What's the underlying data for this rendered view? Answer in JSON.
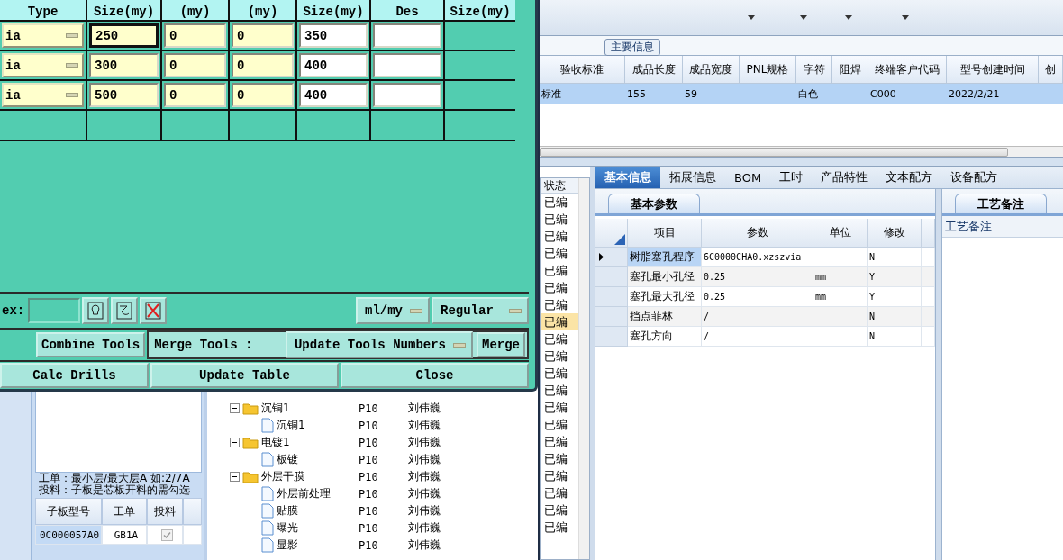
{
  "dialog": {
    "columns": [
      "Type",
      "Size(my)",
      "(my)",
      "(my)",
      "Size(my)",
      "Des",
      "Size(my)"
    ],
    "rows": [
      {
        "type": "ia",
        "size": "250",
        "col_3": "0",
        "col_4": "0",
        "col_5": "350",
        "focused": true
      },
      {
        "type": "ia",
        "size": "300",
        "col_3": "0",
        "col_4": "0",
        "col_5": "400",
        "focused": false
      },
      {
        "type": "ia",
        "size": "500",
        "col_3": "0",
        "col_4": "0",
        "col_5": "400",
        "focused": false
      }
    ],
    "index_label": "ex:",
    "unit": "ml/my",
    "mode": "Regular",
    "combine_button": "Combine Tools",
    "merge_label": "Merge Tools :",
    "merge_option": "Update Tools Numbers",
    "merge_button": "Merge",
    "buttons": [
      "Calc Drills",
      "Update Table",
      "Close"
    ]
  },
  "left_panel": {
    "note_lines": [
      "工单：最小层/最大层A 如:2/7A",
      "投料：子板是芯板开料的需勾选"
    ],
    "columns": [
      "子板型号",
      "工单",
      "投料"
    ],
    "rows": [
      {
        "board": "0C000057A0",
        "order": "GB1A",
        "feed": true
      }
    ]
  },
  "tree": [
    {
      "name": "沉铜1",
      "code": "P10",
      "owner": "刘伟巍",
      "expanded": true,
      "children": [
        {
          "name": "沉铜1",
          "code": "P10",
          "owner": "刘伟巍"
        }
      ]
    },
    {
      "name": "电镀1",
      "code": "P10",
      "owner": "刘伟巍",
      "expanded": true,
      "children": [
        {
          "name": "板镀",
          "code": "P10",
          "owner": "刘伟巍"
        }
      ]
    },
    {
      "name": "外层干膜",
      "code": "P10",
      "owner": "刘伟巍",
      "expanded": true,
      "children": [
        {
          "name": "外层前处理",
          "code": "P10",
          "owner": "刘伟巍"
        },
        {
          "name": "贴膜",
          "code": "P10",
          "owner": "刘伟巍"
        },
        {
          "name": "曝光",
          "code": "P10",
          "owner": "刘伟巍"
        },
        {
          "name": "显影",
          "code": "P10",
          "owner": "刘伟巍"
        }
      ]
    }
  ],
  "main_info": {
    "title": "主要信息",
    "columns": [
      "验收标准",
      "成品长度",
      "成品宽度",
      "PNL规格",
      "字符",
      "阻焊",
      "终端客户代码",
      "型号创建时间",
      "创"
    ],
    "rows": [
      {
        "selected": true,
        "cells": [
          "标准",
          "155",
          "59",
          null,
          "白色",
          null,
          "C000",
          "2022/2/21",
          null
        ]
      }
    ]
  },
  "status": {
    "header": "状态",
    "rows": [
      {
        "text": "已编",
        "selected": false
      },
      {
        "text": "已编",
        "selected": false
      },
      {
        "text": "已编",
        "selected": false
      },
      {
        "text": "已编",
        "selected": false
      },
      {
        "text": "已编",
        "selected": false
      },
      {
        "text": "已编",
        "selected": false
      },
      {
        "text": "已编",
        "selected": false
      },
      {
        "text": "已编",
        "selected": true
      },
      {
        "text": "已编",
        "selected": false
      },
      {
        "text": "已编",
        "selected": false
      },
      {
        "text": "已编",
        "selected": false
      },
      {
        "text": "已编",
        "selected": false
      },
      {
        "text": "已编",
        "selected": false
      },
      {
        "text": "已编",
        "selected": false
      },
      {
        "text": "已编",
        "selected": false
      },
      {
        "text": "已编",
        "selected": false
      },
      {
        "text": "已编",
        "selected": false
      },
      {
        "text": "已编",
        "selected": false
      },
      {
        "text": "已编",
        "selected": false
      },
      {
        "text": "已编",
        "selected": false
      }
    ]
  },
  "tabs": [
    {
      "label": "基本信息",
      "selected": true
    },
    {
      "label": "拓展信息",
      "selected": false
    },
    {
      "label": "BOM",
      "selected": false
    },
    {
      "label": "工时",
      "selected": false
    },
    {
      "label": "产品特性",
      "selected": false
    },
    {
      "label": "文本配方",
      "selected": false
    },
    {
      "label": "设备配方",
      "selected": false
    }
  ],
  "params": {
    "tab": "基本参数",
    "columns": [
      "项目",
      "参数",
      "单位",
      "修改"
    ],
    "rows": [
      {
        "item": "树脂塞孔程序",
        "value": "6C0000CHA0.xzszvia",
        "modified": "N",
        "current": true
      },
      {
        "item": "塞孔最小孔径",
        "value": "0.25",
        "unit": "mm",
        "modified": "Y",
        "current": false
      },
      {
        "item": "塞孔最大孔径",
        "value": "0.25",
        "unit": "mm",
        "modified": "Y",
        "current": false
      },
      {
        "item": "挡点菲林",
        "value": "/",
        "modified": "N",
        "current": false
      },
      {
        "item": "塞孔方向",
        "value": "/",
        "modified": "N",
        "current": false
      }
    ]
  },
  "notes": {
    "tab": "工艺备注",
    "label": "工艺备注"
  }
}
